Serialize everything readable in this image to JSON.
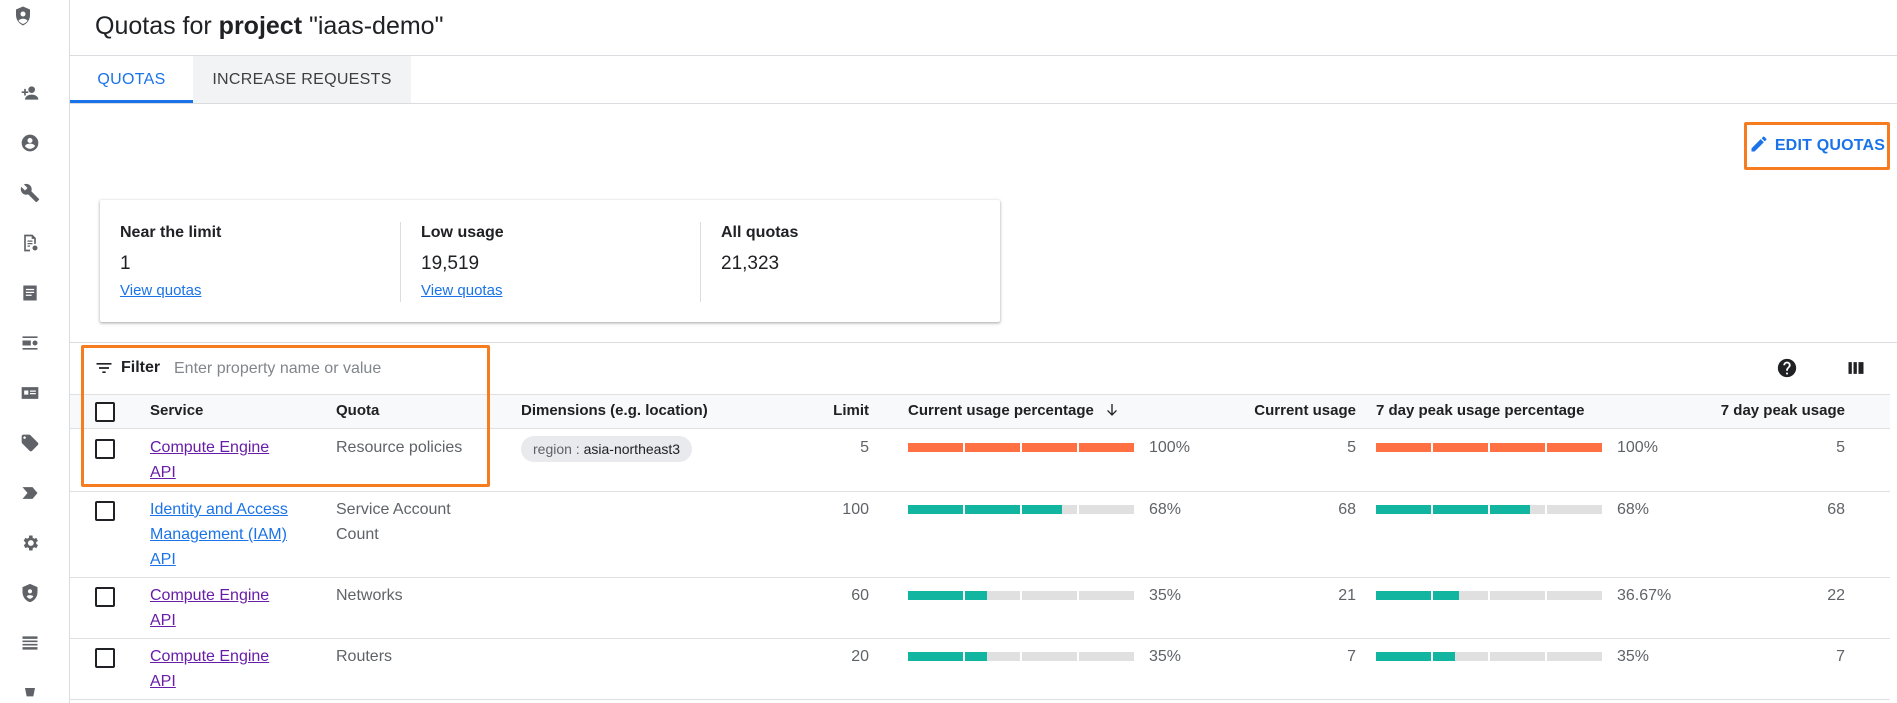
{
  "header": {
    "title_prefix": "Quotas for ",
    "title_bold": "project",
    "title_suffix": " \"iaas-demo\""
  },
  "tabs": [
    {
      "label": "QUOTAS",
      "active": true
    },
    {
      "label": "INCREASE REQUESTS",
      "active": false
    }
  ],
  "edit_button": {
    "label": "EDIT QUOTAS",
    "icon": "pencil-icon"
  },
  "summary": [
    {
      "label": "Near the limit",
      "value": "1",
      "link": "View quotas"
    },
    {
      "label": "Low usage",
      "value": "19,519",
      "link": "View quotas"
    },
    {
      "label": "All quotas",
      "value": "21,323",
      "link": ""
    }
  ],
  "filter": {
    "label": "Filter",
    "placeholder": "Enter property name or value"
  },
  "table": {
    "headers": {
      "service": "Service",
      "quota": "Quota",
      "dimensions": "Dimensions (e.g. location)",
      "limit": "Limit",
      "current_pct": "Current usage percentage",
      "current_usage": "Current usage",
      "peak_pct": "7 day peak usage percentage",
      "peak_usage": "7 day peak usage"
    },
    "rows": [
      {
        "service": [
          "Compute Engine",
          "API"
        ],
        "quota": [
          "Resource policies"
        ],
        "dim_key": "region : ",
        "dim_val": "asia-northeast3",
        "limit": "5",
        "current_pct": "100%",
        "current_fraction": 1.0,
        "current_usage": "5",
        "peak_pct": "100%",
        "peak_fraction": 1.0,
        "peak_usage": "5",
        "status_color": "#ff7043",
        "visited": true
      },
      {
        "service": [
          "Identity and Access",
          "Management (IAM)",
          "API"
        ],
        "quota": [
          "Service Account",
          "Count"
        ],
        "dim_key": "",
        "dim_val": "",
        "limit": "100",
        "current_pct": "68%",
        "current_fraction": 0.68,
        "current_usage": "68",
        "peak_pct": "68%",
        "peak_fraction": 0.68,
        "peak_usage": "68",
        "status_color": "#12b5a0",
        "visited": false
      },
      {
        "service": [
          "Compute Engine",
          "API"
        ],
        "quota": [
          "Networks"
        ],
        "dim_key": "",
        "dim_val": "",
        "limit": "60",
        "current_pct": "35%",
        "current_fraction": 0.35,
        "current_usage": "21",
        "peak_pct": "36.67%",
        "peak_fraction": 0.3667,
        "peak_usage": "22",
        "status_color": "#12b5a0",
        "visited": true
      },
      {
        "service": [
          "Compute Engine",
          "API"
        ],
        "quota": [
          "Routers"
        ],
        "dim_key": "",
        "dim_val": "",
        "limit": "20",
        "current_pct": "35%",
        "current_fraction": 0.35,
        "current_usage": "7",
        "peak_pct": "35%",
        "peak_fraction": 0.35,
        "peak_usage": "7",
        "status_color": "#12b5a0",
        "visited": true
      }
    ]
  },
  "rail_icons": [
    "iam-shield-logo",
    "add-person-icon",
    "account-circle-icon",
    "wrench-icon",
    "audit-document-icon",
    "document-icon",
    "list-settings-icon",
    "id-card-icon",
    "tag-icon",
    "label-arrow-icon",
    "gear-icon",
    "security-shield-icon",
    "table-rows-icon",
    "more-icon"
  ],
  "colors": {
    "accent": "#1a73e8",
    "highlight": "#f57c1f",
    "ok": "#12b5a0",
    "warn": "#ff7043"
  }
}
